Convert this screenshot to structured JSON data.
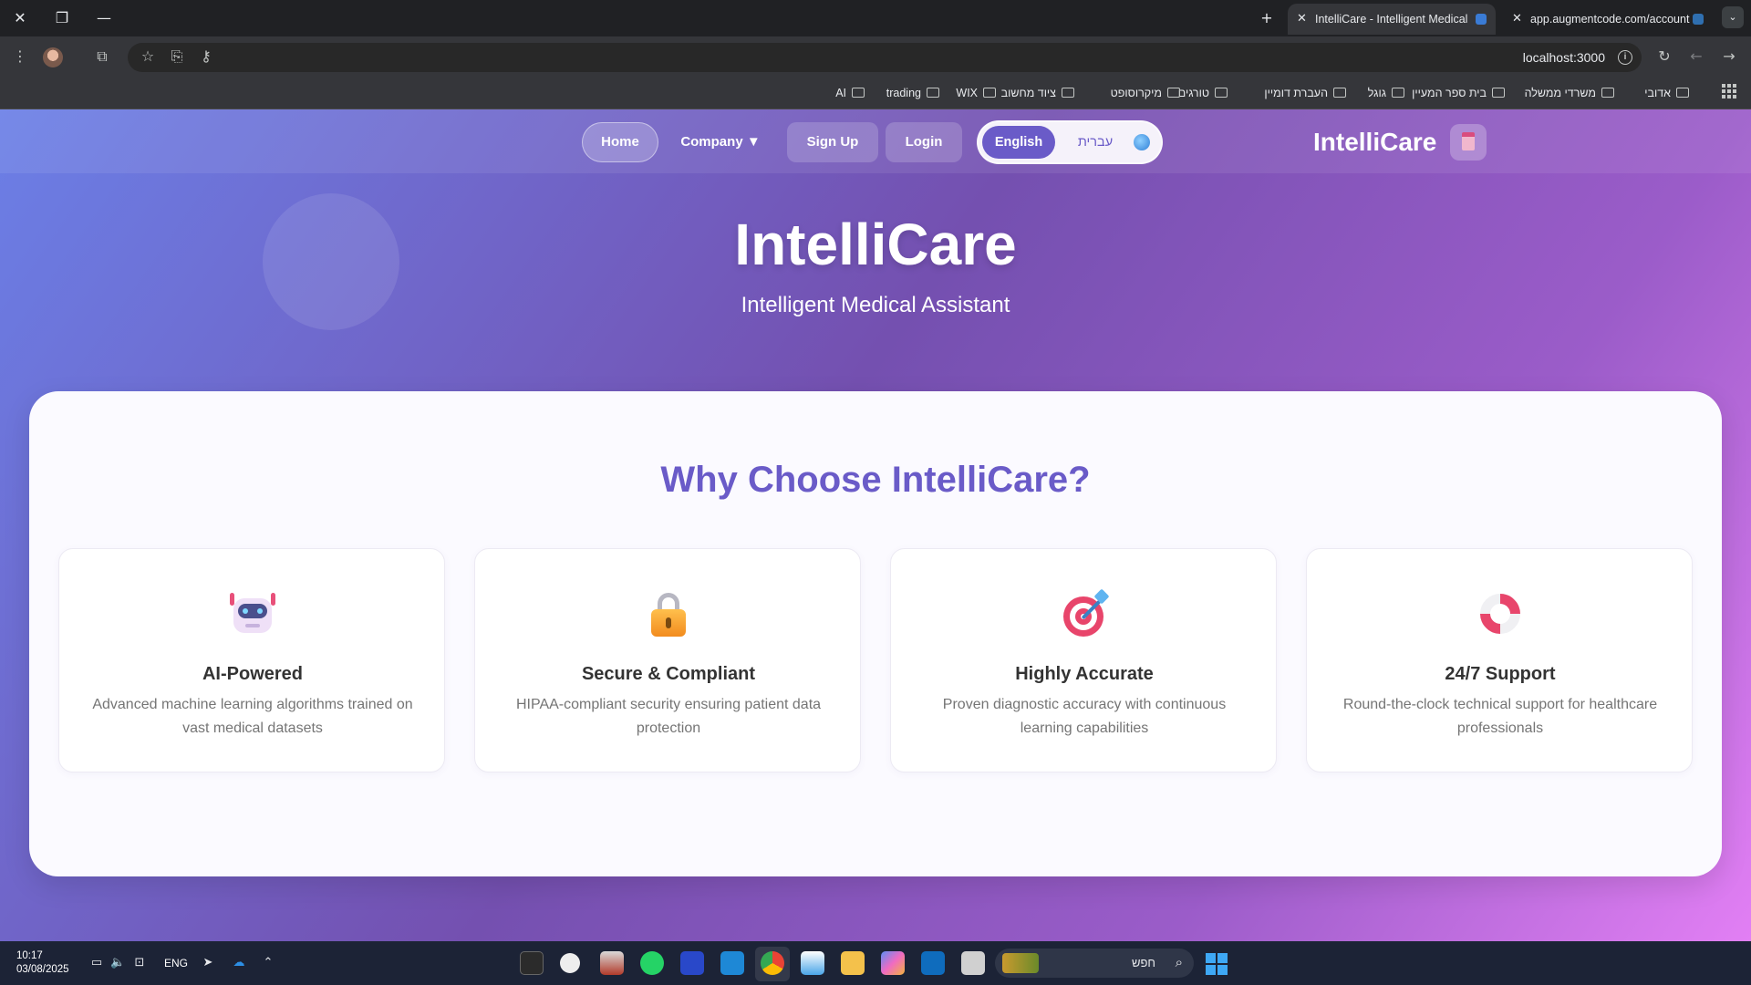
{
  "browser": {
    "window_controls": {
      "close": "✕",
      "restore": "❐",
      "minimize": "—"
    },
    "new_tab": "+",
    "tabs": [
      {
        "title": "IntelliCare - Intelligent Medical",
        "active": true
      },
      {
        "title": "app.augmentcode.com/account",
        "active": false
      }
    ],
    "tab_list": "⌄",
    "address": "localhost:3000",
    "bookmarks": [
      {
        "label": "אדובי"
      },
      {
        "label": "משרדי ממשלה"
      },
      {
        "label": "בית ספר המעיין"
      },
      {
        "label": "גוגל"
      },
      {
        "label": "העברת דומיין"
      },
      {
        "label": "טורגים"
      },
      {
        "label": "מיקרוסופט"
      },
      {
        "label": "ציוד מחשוב"
      },
      {
        "label": "WIX"
      },
      {
        "label": "trading"
      },
      {
        "label": "AI"
      }
    ]
  },
  "nav": {
    "home": "Home",
    "company": "Company ▼",
    "signup": "Sign Up",
    "login": "Login",
    "lang_en": "English",
    "lang_he": "עברית",
    "brand": "IntelliCare"
  },
  "hero": {
    "title": "IntelliCare",
    "subtitle": "Intelligent Medical Assistant"
  },
  "features": {
    "heading": "Why Choose IntelliCare?",
    "items": [
      {
        "icon": "robot-icon",
        "title": "AI-Powered",
        "desc": "Advanced machine learning algorithms trained on vast medical datasets"
      },
      {
        "icon": "lock-icon",
        "title": "Secure & Compliant",
        "desc": "HIPAA-compliant security ensuring patient data protection"
      },
      {
        "icon": "target-icon",
        "title": "Highly Accurate",
        "desc": "Proven diagnostic accuracy with continuous learning capabilities"
      },
      {
        "icon": "lifebuoy-icon",
        "title": "24/7 Support",
        "desc": "Round-the-clock technical support for healthcare professionals"
      }
    ]
  },
  "taskbar": {
    "time": "10:17",
    "date": "03/08/2025",
    "lang": "ENG",
    "search_label": "חפש"
  },
  "colors": {
    "accent": "#6a5bc8",
    "gradient_start": "#6b7fe6",
    "gradient_end": "#e27ff4"
  }
}
